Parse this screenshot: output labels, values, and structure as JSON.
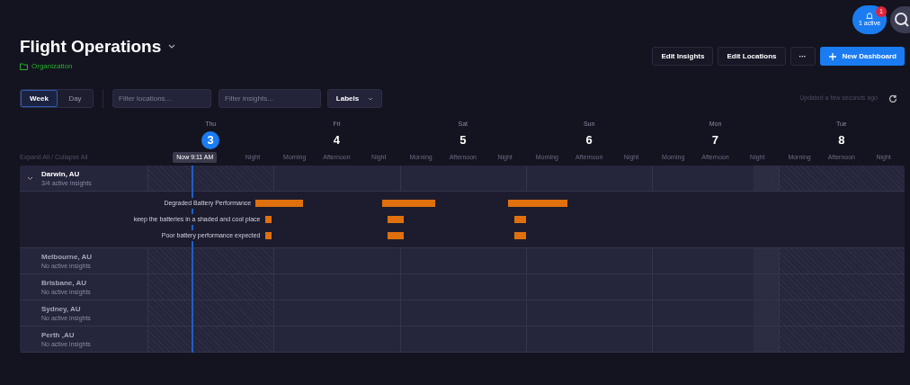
{
  "header": {
    "title": "Flight Operations",
    "organization": "Organization",
    "actions": [
      "Edit Insights",
      "Edit Locations",
      "···"
    ],
    "primary_action": "New Dashboard",
    "notifications": {
      "label": "1 active",
      "count": "1"
    }
  },
  "toolbar": {
    "views": [
      {
        "label": "Week",
        "selected": true
      },
      {
        "label": "Day",
        "selected": false
      }
    ],
    "filters": [
      {
        "placeholder": "Filter locations..."
      },
      {
        "placeholder": "Filter insights..."
      }
    ],
    "labels_button": "Labels",
    "updated": "Updated a few seconds ago"
  },
  "days": [
    {
      "name": "Thu",
      "number": "3",
      "today": true,
      "periods": [
        "Night"
      ]
    },
    {
      "name": "Fri",
      "number": "4",
      "today": false,
      "periods": [
        "Morning",
        "Afternoon",
        "Night"
      ]
    },
    {
      "name": "Sat",
      "number": "5",
      "today": false,
      "periods": [
        "Morning",
        "Afternoon",
        "Night"
      ]
    },
    {
      "name": "Sun",
      "number": "6",
      "today": false,
      "periods": [
        "Morning",
        "Afternoon",
        "Night"
      ]
    },
    {
      "name": "Mon",
      "number": "7",
      "today": false,
      "periods": [
        "Morning",
        "Afternoon",
        "Night"
      ]
    },
    {
      "name": "Tue",
      "number": "8",
      "today": false,
      "periods": [
        "Morning",
        "Afternoon",
        "Night"
      ]
    }
  ],
  "now_marker": "Now 9:11 AM",
  "expand_collapse": "Expand All / Collapse All",
  "locations": [
    {
      "name": "Darwin, AU",
      "subtitle": "3/4 active insights",
      "expanded": true,
      "insights": [
        {
          "label": "Degraded Battery Performance"
        },
        {
          "label": "keep the batteries in a shaded and cool place"
        },
        {
          "label": "Poor battery performance expected"
        }
      ]
    },
    {
      "name": "Melbourne, AU",
      "subtitle": "No active insights",
      "expanded": false
    },
    {
      "name": "Brisbane, AU",
      "subtitle": "No active insights",
      "expanded": false
    },
    {
      "name": "Sydney, AU",
      "subtitle": "No active insights",
      "expanded": false
    },
    {
      "name": "Perth ,AU",
      "subtitle": "No active insights",
      "expanded": false
    }
  ]
}
